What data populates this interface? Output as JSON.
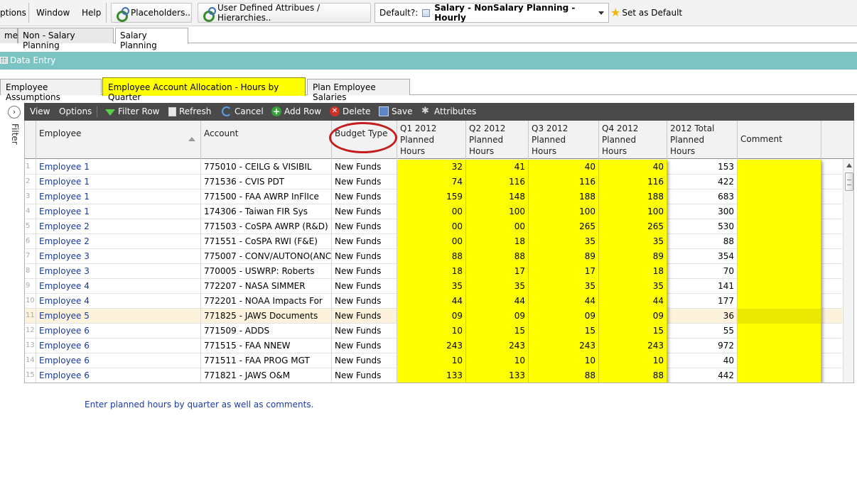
{
  "menu": {
    "options": "ptions",
    "window": "Window",
    "help": "Help"
  },
  "toolbar": {
    "placeholders": "Placeholders..",
    "user_defined": "User Defined Attribues / Hierarchies..",
    "default_label": "Default?:",
    "default_value": "Salary - NonSalary Planning - Hourly",
    "set_default": "Set as Default"
  },
  "page_tabs": [
    "me",
    "Non - Salary Planning",
    "Salary Planning"
  ],
  "section_title": "Data Entry",
  "sub_tabs": [
    "Employee Assumptions",
    "Employee Account Allocation - Hours by Quarter",
    "Plan Employee Salaries"
  ],
  "filter_label": "Filter",
  "grid_toolbar": {
    "view": "View",
    "options": "Options",
    "filter_row": "Filter Row",
    "refresh": "Refresh",
    "cancel": "Cancel",
    "add_row": "Add Row",
    "delete": "Delete",
    "save": "Save",
    "attributes": "Attributes"
  },
  "columns": {
    "employee": "Employee",
    "account": "Account",
    "budget_type": "Budget Type",
    "q1_l1": "Q1 2012",
    "q1_l2": "Planned",
    "q1_l3": "Hours",
    "q2_l1": "Q2 2012",
    "q2_l2": "Planned",
    "q2_l3": "Hours",
    "q3_l1": "Q3 2012",
    "q3_l2": "Planned",
    "q3_l3": "Hours",
    "q4_l1": "Q4 2012",
    "q4_l2": "Planned",
    "q4_l3": "Hours",
    "tot_l1": "2012 Total",
    "tot_l2": "Planned",
    "tot_l3": "Hours",
    "comment": "Comment"
  },
  "rows": [
    {
      "n": "1",
      "emp": "Employee 1",
      "acc": "775010 - CEILG & VISIBIL",
      "bud": "New Funds",
      "q1": "32",
      "q2": "41",
      "q3": "40",
      "q4": "40",
      "tot": "153",
      "com": ""
    },
    {
      "n": "2",
      "emp": "Employee 1",
      "acc": "771536 - CVIS PDT",
      "bud": "New Funds",
      "q1": "74",
      "q2": "116",
      "q3": "116",
      "q4": "116",
      "tot": "422",
      "com": ""
    },
    {
      "n": "3",
      "emp": "Employee 1",
      "acc": "771500 - FAA AWRP InFlIce",
      "bud": "New Funds",
      "q1": "159",
      "q2": "148",
      "q3": "188",
      "q4": "188",
      "tot": "683",
      "com": ""
    },
    {
      "n": "4",
      "emp": "Employee 1",
      "acc": "174306 - Taiwan FIR Sys",
      "bud": "New Funds",
      "q1": "00",
      "q2": "100",
      "q3": "100",
      "q4": "100",
      "tot": "300",
      "com": ""
    },
    {
      "n": "5",
      "emp": "Employee 2",
      "acc": "771503 - CoSPA AWRP (R&D)",
      "bud": "New Funds",
      "q1": "00",
      "q2": "00",
      "q3": "265",
      "q4": "265",
      "tot": "530",
      "com": ""
    },
    {
      "n": "6",
      "emp": "Employee 2",
      "acc": "771551 - CoSPA RWI (F&E)",
      "bud": "New Funds",
      "q1": "00",
      "q2": "18",
      "q3": "35",
      "q4": "35",
      "tot": "88",
      "com": ""
    },
    {
      "n": "7",
      "emp": "Employee 3",
      "acc": "775007 - CONV/AUTONO(ANC)",
      "bud": "New Funds",
      "q1": "88",
      "q2": "88",
      "q3": "89",
      "q4": "89",
      "tot": "354",
      "com": ""
    },
    {
      "n": "8",
      "emp": "Employee 3",
      "acc": "770005 - USWRP: Roberts",
      "bud": "New Funds",
      "q1": "18",
      "q2": "17",
      "q3": "17",
      "q4": "18",
      "tot": "70",
      "com": ""
    },
    {
      "n": "9",
      "emp": "Employee 4",
      "acc": "772207 - NASA SIMMER",
      "bud": "New Funds",
      "q1": "35",
      "q2": "35",
      "q3": "35",
      "q4": "35",
      "tot": "141",
      "com": ""
    },
    {
      "n": "10",
      "emp": "Employee 4",
      "acc": "772201 - NOAA Impacts For",
      "bud": "New Funds",
      "q1": "44",
      "q2": "44",
      "q3": "44",
      "q4": "44",
      "tot": "177",
      "com": ""
    },
    {
      "n": "11",
      "emp": "Employee 5",
      "acc": "771825 - JAWS Documents",
      "bud": "New Funds",
      "q1": "09",
      "q2": "09",
      "q3": "09",
      "q4": "09",
      "tot": "36",
      "com": ""
    },
    {
      "n": "12",
      "emp": "Employee 6",
      "acc": "771509 - ADDS",
      "bud": "New Funds",
      "q1": "10",
      "q2": "15",
      "q3": "15",
      "q4": "15",
      "tot": "55",
      "com": ""
    },
    {
      "n": "13",
      "emp": "Employee 6",
      "acc": "771515 - FAA NNEW",
      "bud": "New Funds",
      "q1": "243",
      "q2": "243",
      "q3": "243",
      "q4": "243",
      "tot": "972",
      "com": ""
    },
    {
      "n": "14",
      "emp": "Employee 6",
      "acc": "771511 - FAA PROG MGT",
      "bud": "New Funds",
      "q1": "10",
      "q2": "10",
      "q3": "10",
      "q4": "10",
      "tot": "40",
      "com": ""
    },
    {
      "n": "15",
      "emp": "Employee 6",
      "acc": "771821 - JAWS O&M",
      "bud": "New Funds",
      "q1": "133",
      "q2": "133",
      "q3": "88",
      "q4": "88",
      "tot": "442",
      "com": ""
    }
  ],
  "selected_row": 10,
  "hint_text": "Enter planned hours by quarter as well as comments.",
  "colors": {
    "highlight": "#ffff00",
    "teal": "#7cc3c3",
    "toolbar_dark": "#4a4a4a",
    "annotation": "#c41d1d",
    "link_text": "#1a3a9b"
  }
}
